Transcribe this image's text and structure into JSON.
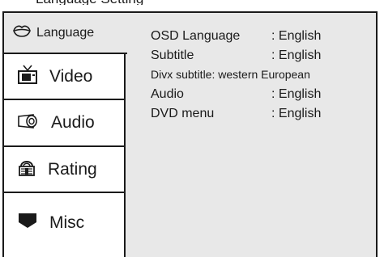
{
  "menu": {
    "tabs": [
      {
        "label": "Language",
        "icon": "lips-icon",
        "active": true
      },
      {
        "label": "Video",
        "icon": "tv-icon",
        "active": false
      },
      {
        "label": "Audio",
        "icon": "speaker-icon",
        "active": false
      },
      {
        "label": "Rating",
        "icon": "lock-icon",
        "active": false
      },
      {
        "label": "Misc",
        "icon": "misc-icon",
        "active": false
      }
    ]
  },
  "settings": {
    "osd_language": {
      "name": "OSD Language",
      "value": ": English"
    },
    "subtitle": {
      "name": "Subtitle",
      "value": ": English"
    },
    "divx_subtitle": {
      "name": "Divx subtitle: western European"
    },
    "audio": {
      "name": "Audio",
      "value": ": English"
    },
    "dvd_menu": {
      "name": "DVD menu",
      "value": ": English"
    }
  },
  "colors": {
    "panel": "#e8e8e8",
    "tab": "#ffffff",
    "text": "#1a1a1a"
  }
}
